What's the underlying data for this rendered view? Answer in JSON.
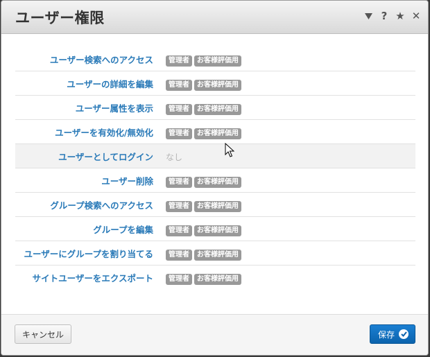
{
  "dialog": {
    "title": "ユーザー権限",
    "header_icons": [
      "chevron-down-icon",
      "help-icon",
      "star-icon",
      "close-icon"
    ]
  },
  "permissions": [
    {
      "label": "ユーザー検索へのアクセス",
      "tags": [
        "管理者",
        "お客様評価用"
      ]
    },
    {
      "label": "ユーザーの詳細を編集",
      "tags": [
        "管理者",
        "お客様評価用"
      ]
    },
    {
      "label": "ユーザー属性を表示",
      "tags": [
        "管理者",
        "お客様評価用"
      ]
    },
    {
      "label": "ユーザーを有効化/無効化",
      "tags": [
        "管理者",
        "お客様評価用"
      ]
    },
    {
      "label": "ユーザーとしてログイン",
      "tags": [],
      "none_text": "なし"
    },
    {
      "label": "ユーザー削除",
      "tags": [
        "管理者",
        "お客様評価用"
      ]
    },
    {
      "label": "グループ検索へのアクセス",
      "tags": [
        "管理者",
        "お客様評価用"
      ]
    },
    {
      "label": "グループを編集",
      "tags": [
        "管理者",
        "お客様評価用"
      ]
    },
    {
      "label": "ユーザーにグループを割り当てる",
      "tags": [
        "管理者",
        "お客様評価用"
      ]
    },
    {
      "label": "サイトユーザーをエクスポート",
      "tags": [
        "管理者",
        "お客様評価用"
      ]
    }
  ],
  "footer": {
    "cancel_label": "キャンセル",
    "save_label": "保存"
  },
  "colors": {
    "label_blue": "#2a7ab8",
    "tag_gray": "#999999",
    "save_blue": "#0b63ad"
  }
}
